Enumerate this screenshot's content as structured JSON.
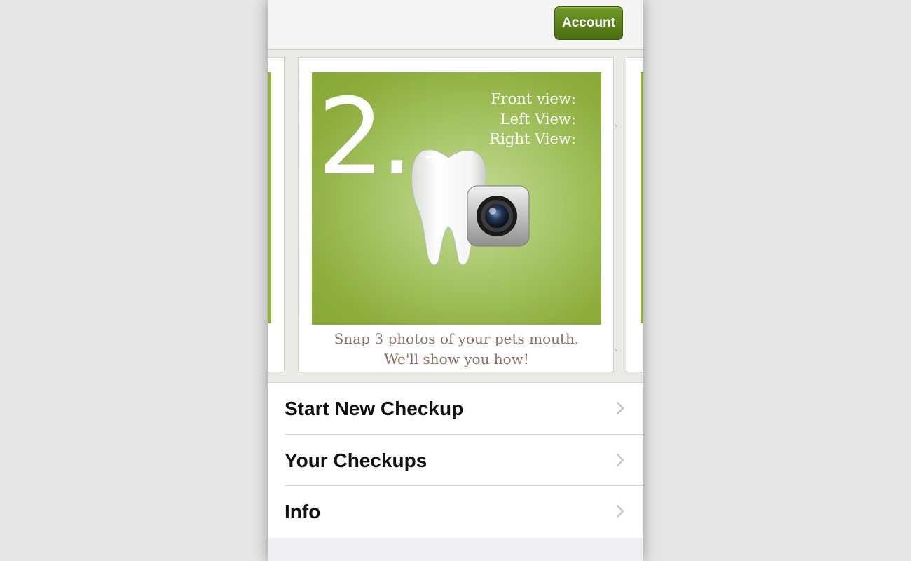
{
  "navbar": {
    "account_label": "Account"
  },
  "colors": {
    "accent_green": "#5a8419",
    "card_green": "#8cad3b",
    "caption_color": "#8a6f64"
  },
  "carousel": {
    "current_card": {
      "step_number": "2.",
      "views": [
        "Front view:",
        "Left View:",
        "Right View:"
      ],
      "caption_lines": [
        "Snap 3 photos of your pets mouth.",
        "We'll show you how!"
      ],
      "icons": [
        "tooth-icon",
        "camera-icon"
      ]
    }
  },
  "menu": {
    "items": [
      {
        "label": "Start New Checkup",
        "icon": "chevron-right-icon"
      },
      {
        "label": "Your Checkups",
        "icon": "chevron-right-icon"
      },
      {
        "label": "Info",
        "icon": "chevron-right-icon"
      }
    ]
  }
}
